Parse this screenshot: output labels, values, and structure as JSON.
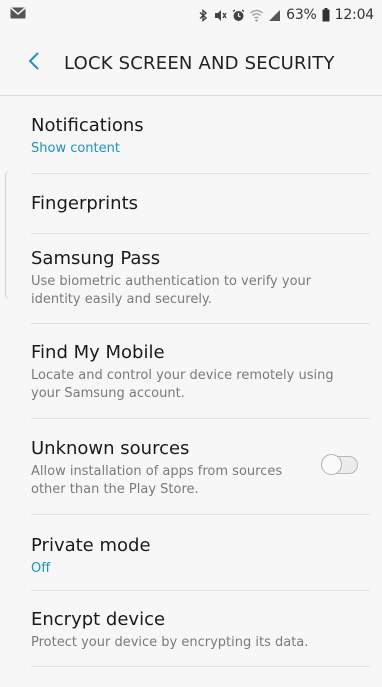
{
  "status_bar": {
    "battery_text": "63%",
    "time": "12:04"
  },
  "header": {
    "back_icon": "chevron-left-icon",
    "title": "LOCK SCREEN AND SECURITY"
  },
  "settings": {
    "items": [
      {
        "title": "Notifications",
        "subtitle": "Show content"
      },
      {
        "title": "Fingerprints"
      },
      {
        "title": "Samsung Pass",
        "subtitle_lines": [
          "Use biometric authentication to verify your",
          "identity easily and securely."
        ]
      },
      {
        "title": "Find My Mobile",
        "subtitle_lines": [
          "Locate and control your device remotely using",
          "your Samsung account."
        ]
      },
      {
        "title": "Unknown sources",
        "subtitle_lines": [
          "Allow installation of apps from sources",
          "other than the Play Store."
        ],
        "toggle_on": false
      },
      {
        "title": "Private mode",
        "subtitle": "Off"
      },
      {
        "title": "Encrypt device",
        "subtitle": "Protect your device by encrypting its data."
      }
    ]
  },
  "colors": {
    "accent": "#1a93c5",
    "background": "#f7f7f7",
    "divider": "#e1e1e1"
  }
}
